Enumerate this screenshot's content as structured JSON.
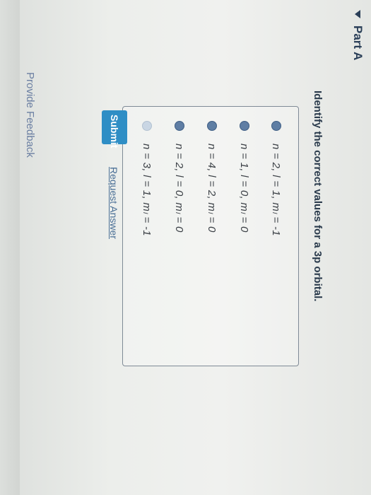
{
  "part": {
    "title": "Part A"
  },
  "question": {
    "text": "Identify the correct values for a 3p orbital."
  },
  "options": [
    {
      "label": "n = 2, l = 1, mₗ = -1"
    },
    {
      "label": "n = 1, l = 0, mₗ = 0"
    },
    {
      "label": "n = 4, l = 2, mₗ = 0"
    },
    {
      "label": "n = 2, l = 0, mₗ = 0"
    },
    {
      "label": "n = 3, l = 1, mₗ = -1"
    }
  ],
  "actions": {
    "submit_label": "Submit",
    "request_answer_label": "Request Answer"
  },
  "footer": {
    "feedback_label": "Provide Feedback"
  },
  "colors": {
    "accent": "#2f8ec5",
    "radio": "#5f7ea4",
    "link": "#4a6f96",
    "title": "#2b3f58"
  }
}
